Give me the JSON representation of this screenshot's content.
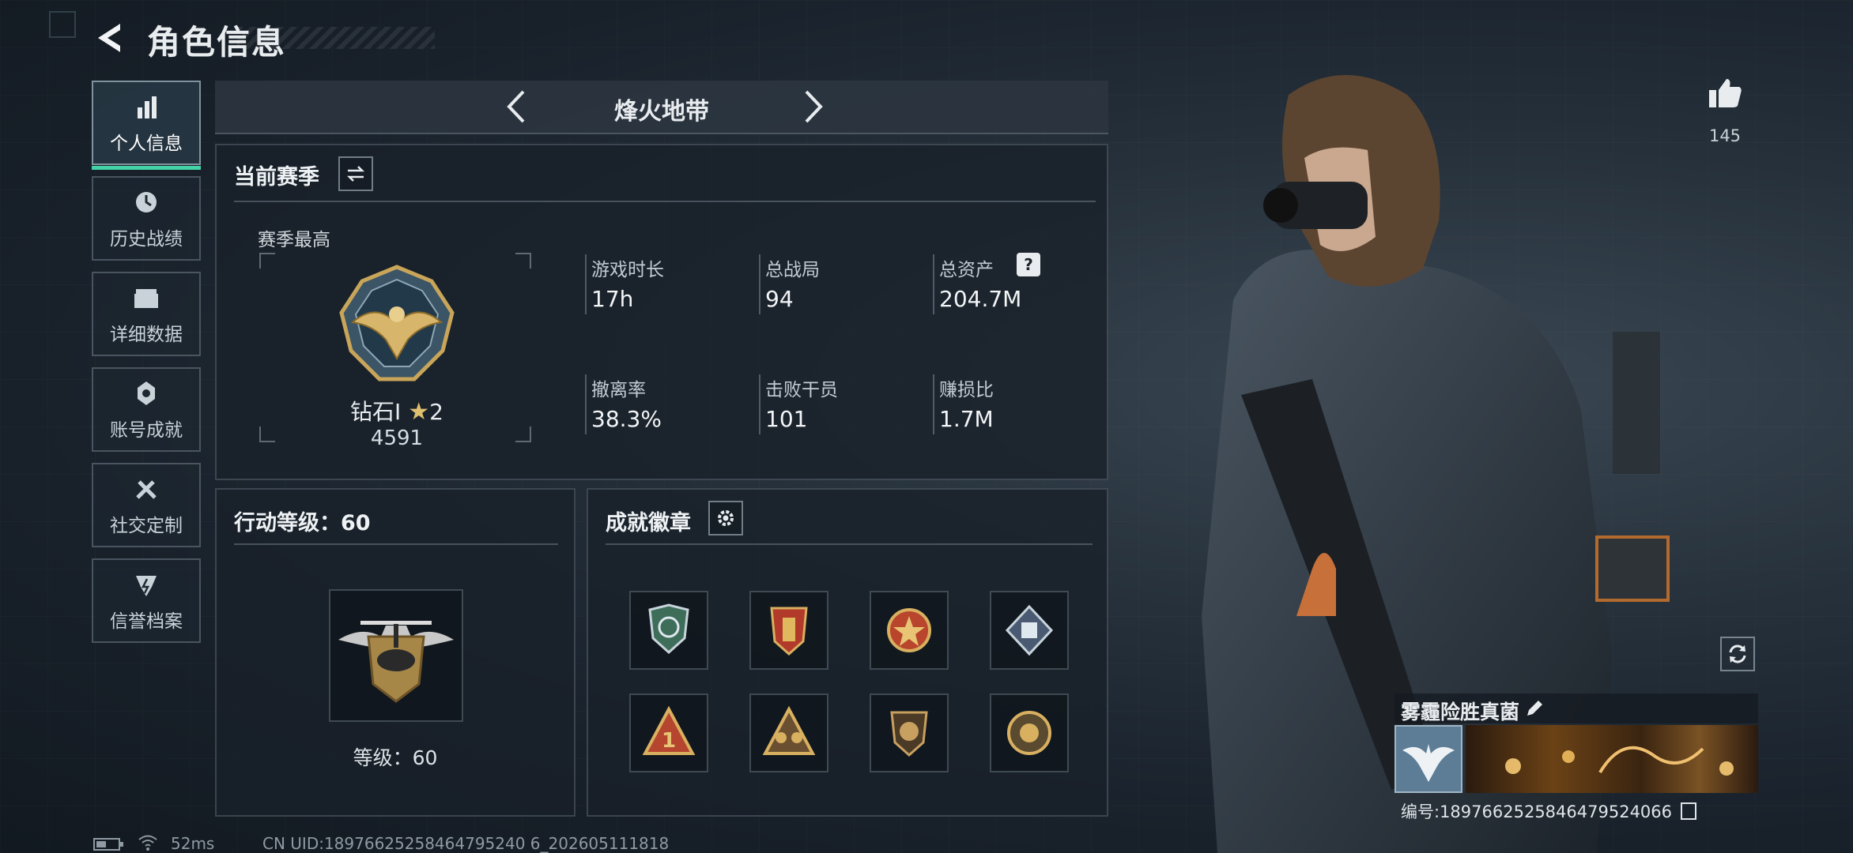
{
  "header": {
    "title": "角色信息"
  },
  "sidebar": {
    "items": [
      {
        "label": "个人信息",
        "icon": "bar-chart-icon",
        "active": true
      },
      {
        "label": "历史战绩",
        "icon": "history-icon",
        "active": false
      },
      {
        "label": "详细数据",
        "icon": "folder-icon",
        "active": false
      },
      {
        "label": "账号成就",
        "icon": "achievement-icon",
        "active": false
      },
      {
        "label": "社交定制",
        "icon": "tools-icon",
        "active": false
      },
      {
        "label": "信誉档案",
        "icon": "credit-icon",
        "active": false
      }
    ]
  },
  "mode": {
    "name": "烽火地带"
  },
  "season": {
    "title": "当前赛季",
    "best_label": "赛季最高",
    "rank_name": "钻石Ⅰ",
    "rank_stars": "2",
    "rank_points": "4591",
    "stats": [
      {
        "label": "游戏时长",
        "value": "17h"
      },
      {
        "label": "总战局",
        "value": "94"
      },
      {
        "label": "总资产",
        "value": "204.7M",
        "help": "?"
      },
      {
        "label": "撤离率",
        "value": "38.3%"
      },
      {
        "label": "击败干员",
        "value": "101"
      },
      {
        "label": "赚损比",
        "value": "1.7M"
      }
    ]
  },
  "action_level": {
    "title": "行动等级：60",
    "level_text": "等级：60"
  },
  "badges": {
    "title": "成就徽章",
    "items": [
      {
        "icon": "shield-badge-icon"
      },
      {
        "icon": "crest-badge-icon"
      },
      {
        "icon": "star-medal-icon"
      },
      {
        "icon": "cube-badge-icon"
      },
      {
        "icon": "number-one-badge-icon"
      },
      {
        "icon": "squad-badge-icon"
      },
      {
        "icon": "lion-shield-icon"
      },
      {
        "icon": "coin-badge-icon"
      }
    ]
  },
  "likes": {
    "count": "145"
  },
  "player": {
    "name": "雾霾险胜真菌",
    "uid_label": "编号:1897662525846479524066"
  },
  "status_bar": {
    "ping": "52ms",
    "uid": "CN UID:18976625258464795240 6_202605111818"
  },
  "colors": {
    "accent": "#43d3a6",
    "gold": "#c9a55a"
  }
}
